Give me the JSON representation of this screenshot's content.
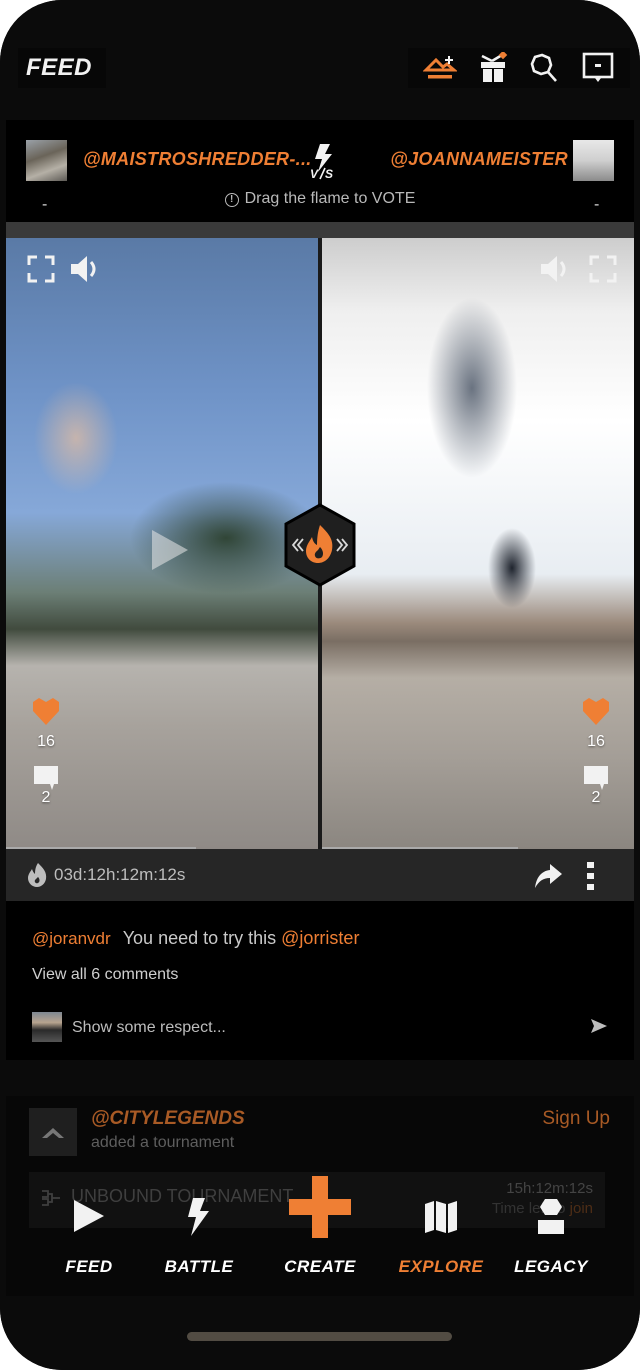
{
  "header": {
    "title": "FEED",
    "icons": [
      "crown-plus-icon",
      "gift-icon",
      "search-icon",
      "message-icon"
    ]
  },
  "battle": {
    "left_user": "@MAISTROSHREDDER-...",
    "right_user": "@JOANNAMEISTER",
    "vs_label": "VS",
    "vote_hint": "Drag the flame to VOTE",
    "left_score": "-",
    "right_score": "-",
    "left_video": {
      "likes": "16",
      "comments": "2"
    },
    "right_video": {
      "likes": "16",
      "comments": "2"
    },
    "timer": "03d:12h:12m:12s"
  },
  "comments": {
    "first": {
      "user": "@joranvdr",
      "text": "You need to try this",
      "mention": "@jorrister"
    },
    "view_all": "View all 6 comments",
    "input_placeholder": "Show some respect..."
  },
  "next_post": {
    "org": "@CITYLEGENDS",
    "action": "added a tournament",
    "signup": "Sign Up",
    "tournament_name": "UNBOUND TOURNAMENT",
    "time": "15h:12m:12s",
    "time_left_label": "Time left to",
    "join": "join"
  },
  "nav": {
    "items": [
      {
        "label": "FEED",
        "icon": "play-icon"
      },
      {
        "label": "BATTLE",
        "icon": "lightning-icon"
      },
      {
        "label": "CREATE",
        "icon": "plus-icon"
      },
      {
        "label": "EXPLORE",
        "icon": "map-icon",
        "active": true
      },
      {
        "label": "LEGACY",
        "icon": "trophy-icon"
      }
    ]
  },
  "colors": {
    "accent": "#ef7f34",
    "background": "#0b0b0b",
    "card": "#000000",
    "footer_bar": "#262626"
  }
}
